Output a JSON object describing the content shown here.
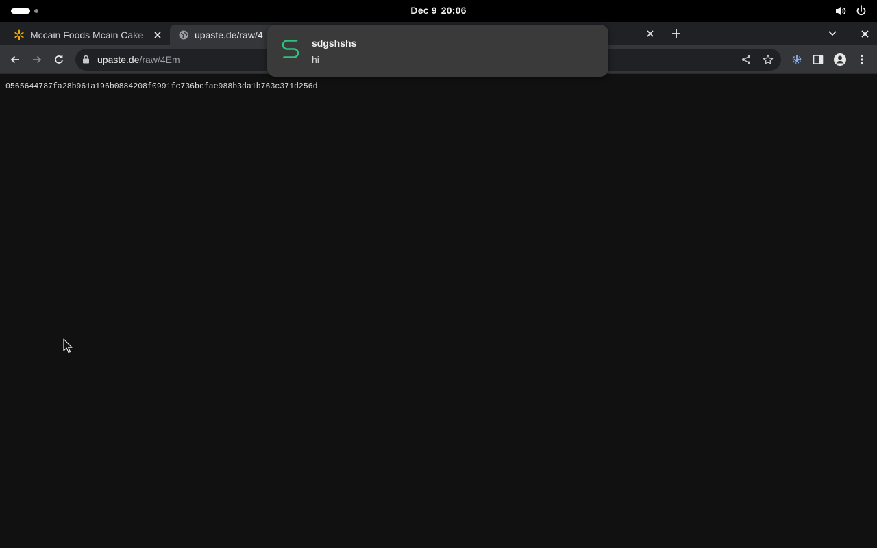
{
  "system": {
    "date": "Dec 9",
    "time": "20:06"
  },
  "tabs": [
    {
      "title": "Mccain Foods Mcain Cake",
      "favicon": "walmart-spark-icon",
      "active": false
    },
    {
      "title": "upaste.de/raw/4",
      "favicon": "globe-icon",
      "active": true
    }
  ],
  "address_bar": {
    "host": "upaste.de",
    "path": "/raw/4Em"
  },
  "page": {
    "raw_text": "0565644787fa28b961a196b0884208f0991fc736bcfae988b3da1b763c371d256d"
  },
  "notification": {
    "title": "sdgshshs",
    "body": "hi",
    "accent_color": "#2ec27e"
  },
  "colors": {
    "page_background": "#111111",
    "toolbar": "#35363a",
    "tabstrip": "#202124"
  }
}
